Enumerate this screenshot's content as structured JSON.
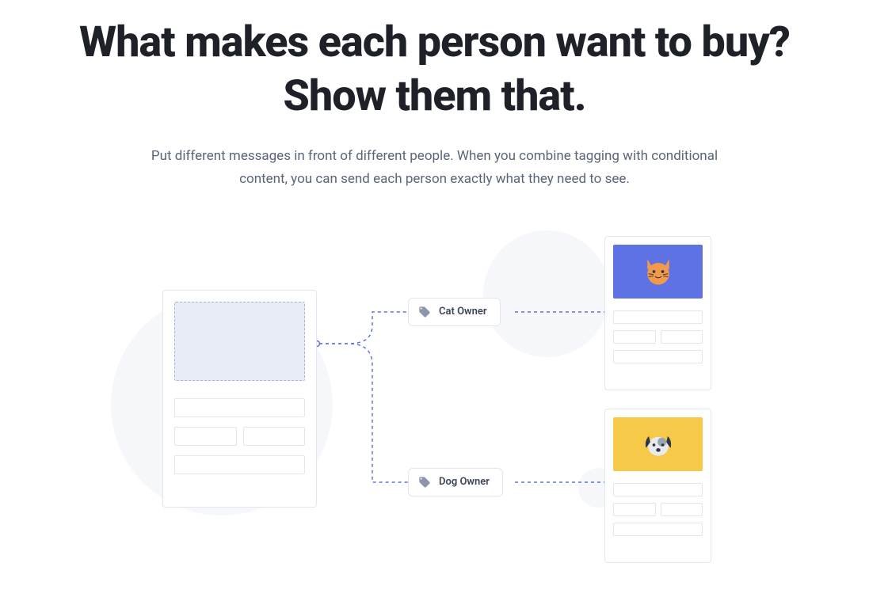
{
  "hero": {
    "title": "What makes each person want to buy? Show them that.",
    "subtitle": "Put different messages in front of different people. When you combine tagging with conditional content, you can send each person exactly what they need to see."
  },
  "tags": {
    "cat": "Cat Owner",
    "dog": "Dog Owner"
  },
  "colors": {
    "cat_bg": "#5e72e4",
    "dog_bg": "#f7c948",
    "connector": "#5e72e4"
  }
}
